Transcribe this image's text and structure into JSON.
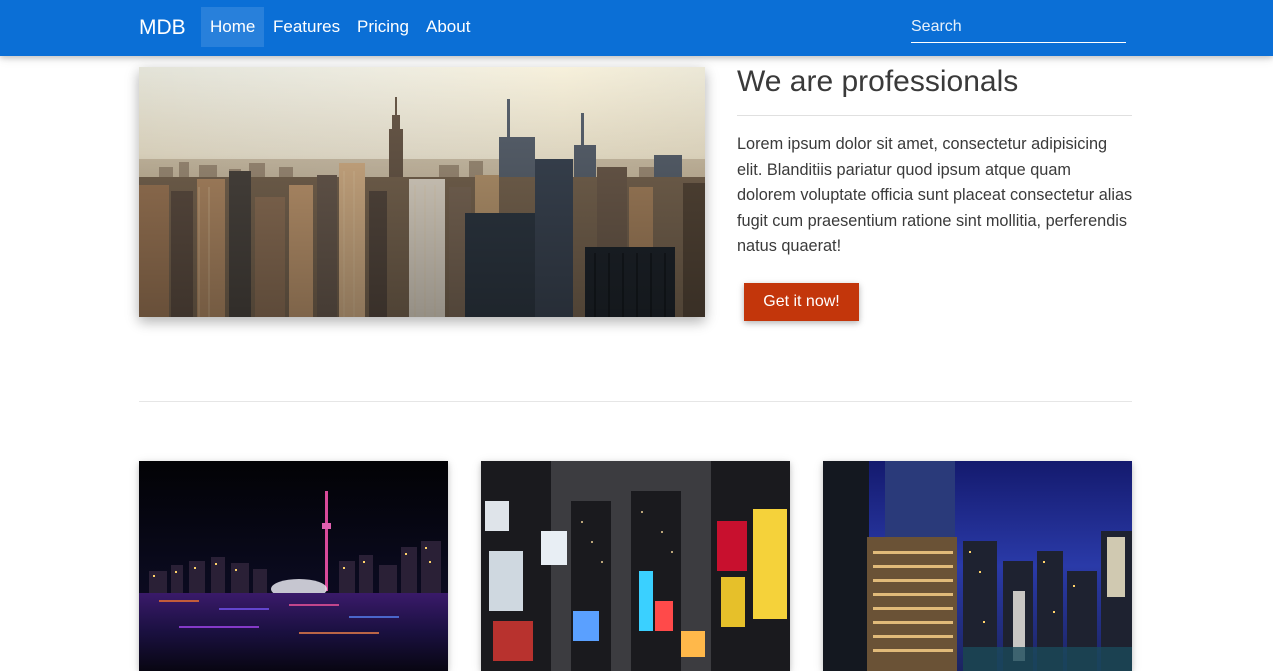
{
  "navbar": {
    "brand": "MDB",
    "items": [
      {
        "label": "Home",
        "active": true
      },
      {
        "label": "Features",
        "active": false
      },
      {
        "label": "Pricing",
        "active": false
      },
      {
        "label": "About",
        "active": false
      }
    ],
    "search_placeholder": "Search",
    "background_color": "#0b6fd6"
  },
  "hero": {
    "image": "city-skyline-sunset-photo",
    "title": "We are professionals",
    "body": "Lorem ipsum dolor sit amet, consectetur adipisicing elit. Blanditiis pariatur quod ipsum atque quam dolorem voluptate officia sunt placeat consectetur alias fugit cum praesentium ratione sint mollitia, perferendis natus quaerat!",
    "cta_label": "Get it now!",
    "cta_color": "#c3360b"
  },
  "gallery": [
    {
      "image": "night-skyline-waterfront-photo"
    },
    {
      "image": "times-square-night-photo"
    },
    {
      "image": "city-towers-dusk-photo"
    }
  ]
}
